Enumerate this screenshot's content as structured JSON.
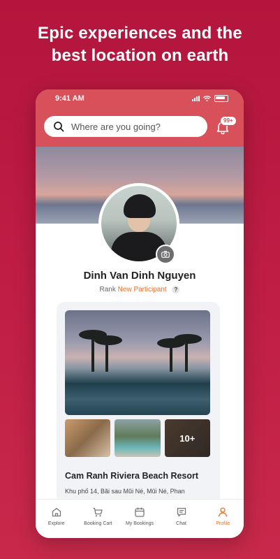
{
  "headline": "Epic experiences and the\nbest location on earth",
  "status_bar": {
    "time": "9:41 AM"
  },
  "search": {
    "placeholder": "Where are you going?"
  },
  "notifications": {
    "badge": "99+"
  },
  "profile": {
    "name": "Dinh Van Dinh Nguyen",
    "rank_label": "Rank",
    "rank_value": "New Participant",
    "rank_help": "?"
  },
  "listing": {
    "name": "Cam Ranh Riviera Beach Resort",
    "address": "Khu phố 14, Bãi sau Mũi Né, Mũi Né, Phan",
    "more_photos": "10+"
  },
  "tabs": [
    {
      "label": "Explore",
      "icon": "home-icon"
    },
    {
      "label": "Booking Cart",
      "icon": "cart-icon"
    },
    {
      "label": "My Bookings",
      "icon": "calendar-icon"
    },
    {
      "label": "Chat",
      "icon": "chat-icon"
    },
    {
      "label": "Profile",
      "icon": "person-icon",
      "active": true
    }
  ],
  "colors": {
    "background": "#b3153c",
    "header": "#d8505a",
    "accent": "#e8712a"
  }
}
